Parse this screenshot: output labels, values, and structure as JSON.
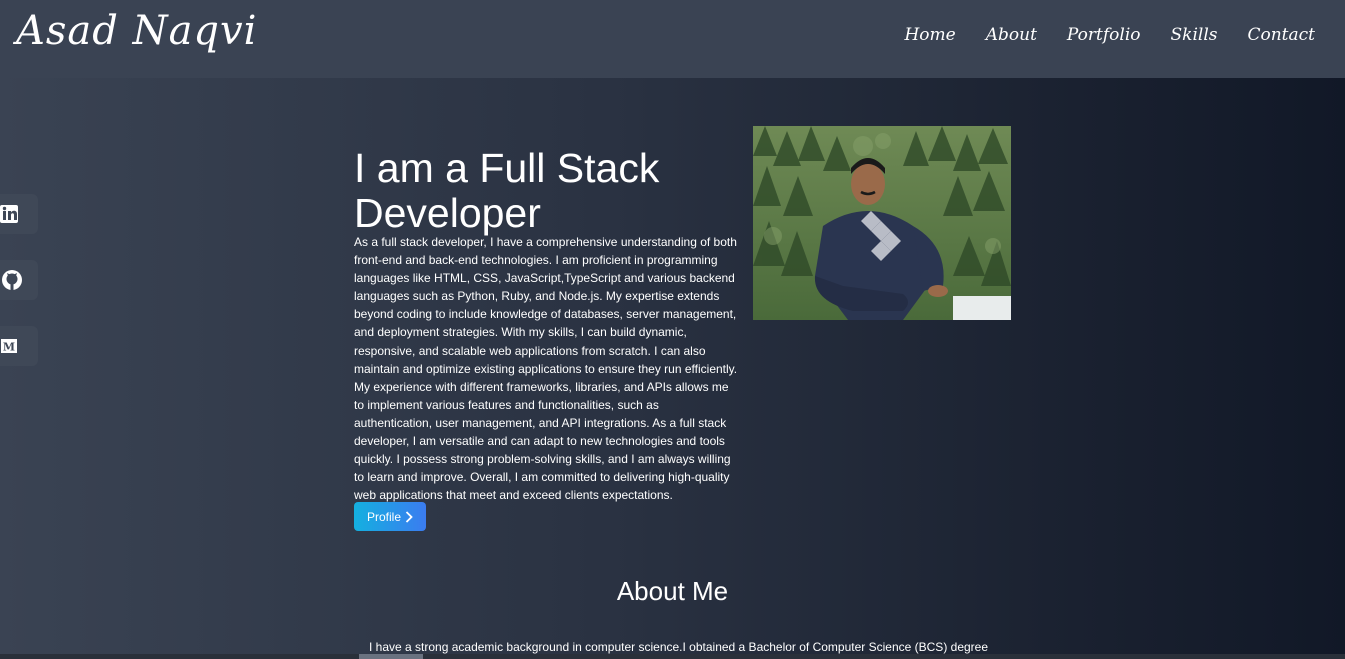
{
  "header": {
    "logo": "Asad Naqvi",
    "nav": [
      "Home",
      "About",
      "Portfolio",
      "Skills",
      "Contact"
    ]
  },
  "social": [
    {
      "name": "linkedin-icon",
      "glyph": "in"
    },
    {
      "name": "github-icon",
      "glyph": ""
    },
    {
      "name": "medium-icon",
      "glyph": "M"
    }
  ],
  "hero": {
    "title": "I am a Full Stack Developer",
    "text": "As a full stack developer, I have a comprehensive understanding of both front-end and back-end technologies. I am proficient in programming languages like HTML, CSS, JavaScript,TypeScript and various backend languages such as Python, Ruby, and Node.js. My expertise extends beyond coding to include knowledge of databases, server management, and deployment strategies. With my skills, I can build dynamic, responsive, and scalable web applications from scratch. I can also maintain and optimize existing applications to ensure they run efficiently. My experience with different frameworks, libraries, and APIs allows me to implement various features and functionalities, such as authentication, user management, and API integrations. As a full stack developer, I am versatile and can adapt to new technologies and tools quickly. I possess strong problem-solving skills, and I am always willing to learn and improve. Overall, I am committed to delivering high-quality web applications that meet and exceed clients expectations.",
    "button": "Profile"
  },
  "about": {
    "title": "About Me",
    "text": "I have a strong academic background in computer science.I obtained a Bachelor of Computer Science (BCS) degree"
  },
  "colors": {
    "header_bg": "#3a4353",
    "button_start": "#14b0e0",
    "button_end": "#3b7cf0"
  }
}
